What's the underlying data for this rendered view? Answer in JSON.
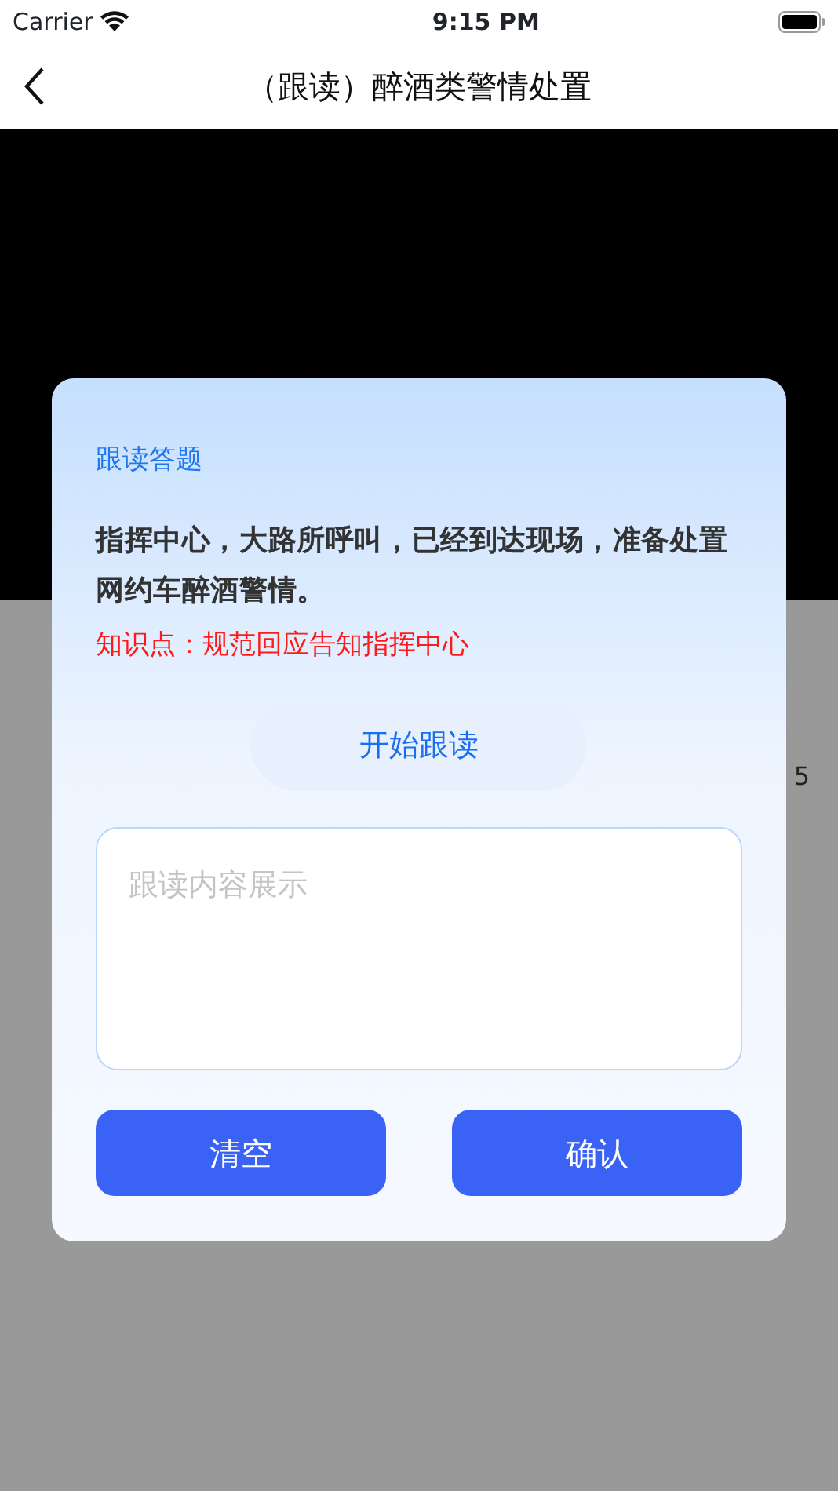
{
  "status_bar": {
    "carrier": "Carrier",
    "time": "9:15 PM"
  },
  "nav": {
    "title": "（跟读）醉酒类警情处置"
  },
  "background": {
    "side_text": "5"
  },
  "dialog": {
    "title": "跟读答题",
    "question": "指挥中心，大路所呼叫，已经到达现场，准备处置网约车醉酒警情。",
    "knowledge": "知识点：规范回应告知指挥中心",
    "start_button": "开始跟读",
    "answer": {
      "placeholder": "跟读内容展示"
    },
    "buttons": [
      {
        "label": "清空"
      },
      {
        "label": "确认"
      }
    ]
  }
}
